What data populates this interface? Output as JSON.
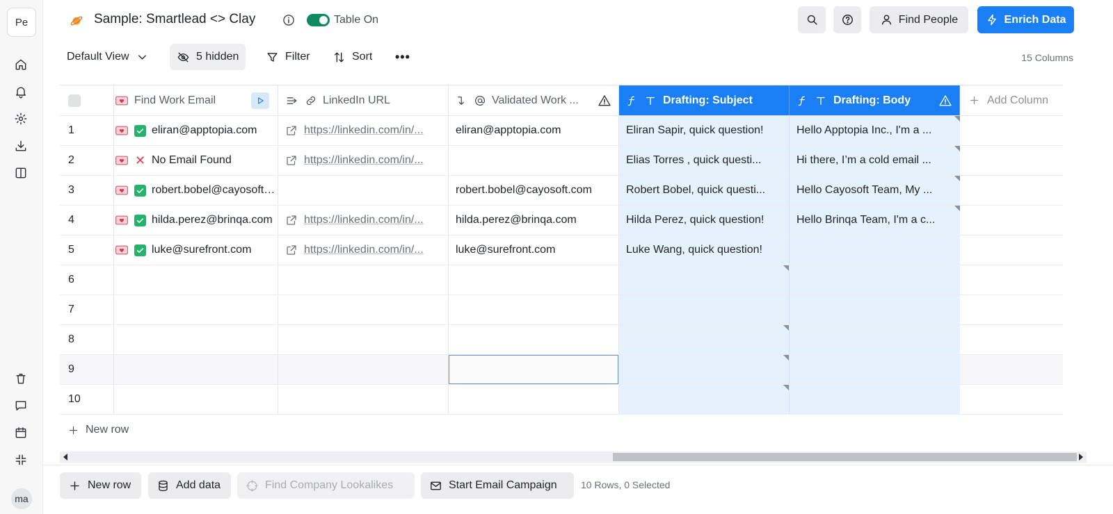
{
  "workspace": {
    "badge": "Pe"
  },
  "user": {
    "initials": "ma"
  },
  "header": {
    "title": "Sample: Smartlead <> Clay",
    "toggle_label": "Table On",
    "find_people": "Find People",
    "enrich_data": "Enrich Data"
  },
  "toolbar": {
    "view": "Default View",
    "hidden": "5 hidden",
    "filter": "Filter",
    "sort": "Sort",
    "more": "•••",
    "column_count": "15 Columns"
  },
  "columns": [
    {
      "label": "Find Work Email"
    },
    {
      "label": "LinkedIn URL"
    },
    {
      "label": "Validated Work ..."
    },
    {
      "label": "Drafting: Subject"
    },
    {
      "label": "Drafting: Body"
    },
    {
      "label": "Add Column"
    }
  ],
  "rows": [
    {
      "n": "1",
      "email_status": "found",
      "email": "eliran@apptopia.com",
      "linkedin": "https://linkedin.com/in/...",
      "validated": "eliran@apptopia.com",
      "subject": "Eliran Sapir, quick question!",
      "body": "Hello Apptopia Inc., I'm a ..."
    },
    {
      "n": "2",
      "email_status": "none",
      "email": "No Email Found",
      "linkedin": "https://linkedin.com/in/...",
      "validated": "",
      "subject": "Elias Torres , quick questi...",
      "body": "Hi there, I’m a cold email ..."
    },
    {
      "n": "3",
      "email_status": "found",
      "email": "robert.bobel@cayosoft.com",
      "linkedin": "",
      "validated": "robert.bobel@cayosoft.com",
      "subject": "Robert Bobel, quick questi...",
      "body": "Hello Cayosoft Team, My ..."
    },
    {
      "n": "4",
      "email_status": "found",
      "email": "hilda.perez@brinqa.com",
      "linkedin": "https://linkedin.com/in/...",
      "validated": "hilda.perez@brinqa.com",
      "subject": "Hilda Perez, quick question!",
      "body": "Hello Brinqa Team, I'm a c..."
    },
    {
      "n": "5",
      "email_status": "found",
      "email": "luke@surefront.com",
      "linkedin": "https://linkedin.com/in/...",
      "validated": "luke@surefront.com",
      "subject": "Luke Wang, quick question!",
      "body": ""
    },
    {
      "n": "6"
    },
    {
      "n": "7"
    },
    {
      "n": "8"
    },
    {
      "n": "9"
    },
    {
      "n": "10"
    }
  ],
  "grid": {
    "new_row": "New row"
  },
  "bottom": {
    "new_row": "New row",
    "add_data": "Add data",
    "find_lookalikes": "Find Company Lookalikes",
    "start_campaign": "Start Email Campaign",
    "status": "10 Rows, 0 Selected"
  },
  "colors": {
    "accent": "#1a7ef5",
    "toggle_on": "#0f8a5f",
    "column_tint": "#e5f1fd",
    "check_green": "#22b46a",
    "error_red": "#e23b4a"
  }
}
